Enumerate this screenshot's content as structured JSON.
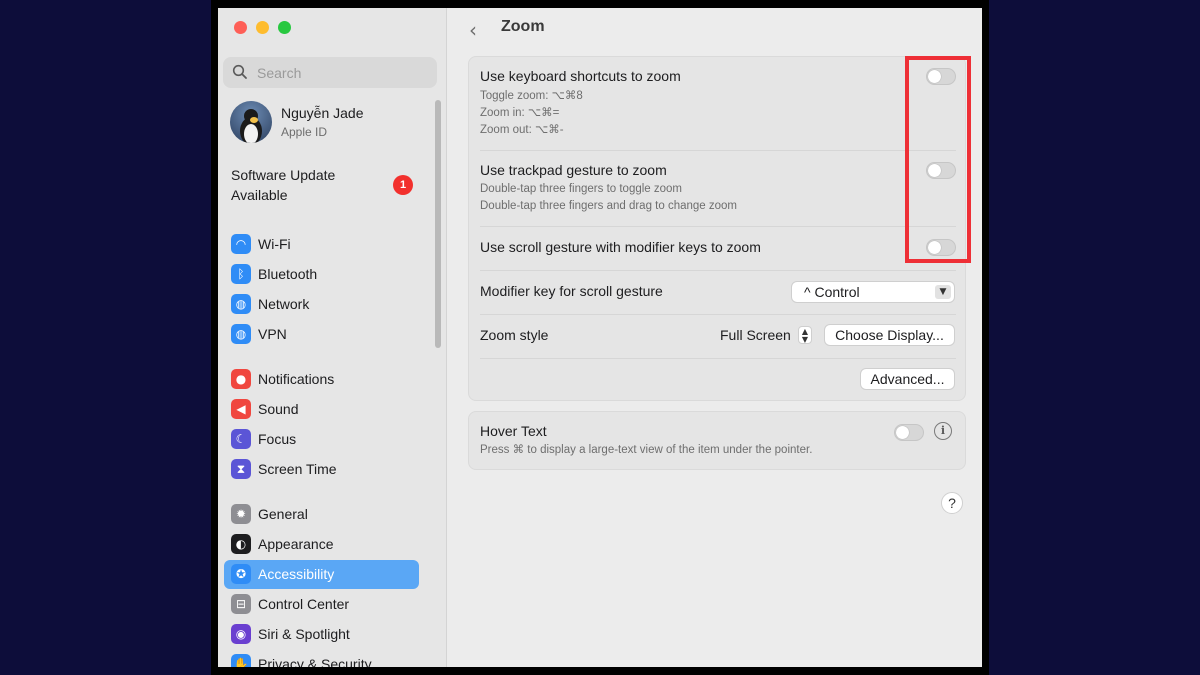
{
  "search": {
    "placeholder": "Search"
  },
  "profile": {
    "name": "Nguyễn Jade",
    "subtitle": "Apple ID"
  },
  "update": {
    "label": "Software Update Available",
    "badge": "1"
  },
  "sidebar": {
    "items": [
      {
        "label": "Wi-Fi",
        "icon": "wifi-icon",
        "color": "#2f8cf6"
      },
      {
        "label": "Bluetooth",
        "icon": "bluetooth-icon",
        "color": "#2f8cf6"
      },
      {
        "label": "Network",
        "icon": "globe-icon",
        "color": "#2f8cf6"
      },
      {
        "label": "VPN",
        "icon": "vpn-globe-icon",
        "color": "#2f8cf6"
      },
      {
        "label": "Notifications",
        "icon": "bell-icon",
        "color": "#f0473f"
      },
      {
        "label": "Sound",
        "icon": "speaker-icon",
        "color": "#f0473f"
      },
      {
        "label": "Focus",
        "icon": "moon-icon",
        "color": "#5b55d6"
      },
      {
        "label": "Screen Time",
        "icon": "hourglass-icon",
        "color": "#5b55d6"
      },
      {
        "label": "General",
        "icon": "gear-icon",
        "color": "#8e8e93"
      },
      {
        "label": "Appearance",
        "icon": "appearance-icon",
        "color": "#1d1d1f"
      },
      {
        "label": "Accessibility",
        "icon": "accessibility-icon",
        "color": "#2f8cf6",
        "active": true
      },
      {
        "label": "Control Center",
        "icon": "switches-icon",
        "color": "#8e8e93"
      },
      {
        "label": "Siri & Spotlight",
        "icon": "siri-icon",
        "color": "#6a3fd0"
      },
      {
        "label": "Privacy & Security",
        "icon": "hand-icon",
        "color": "#2f8cf6"
      }
    ]
  },
  "content": {
    "title": "Zoom",
    "keyboard": {
      "title": "Use keyboard shortcuts to zoom",
      "lines": [
        "Toggle zoom: ⌥⌘8",
        "Zoom in: ⌥⌘=",
        "Zoom out: ⌥⌘-"
      ]
    },
    "trackpad": {
      "title": "Use trackpad gesture to zoom",
      "lines": [
        "Double-tap three fingers to toggle zoom",
        "Double-tap three fingers and drag to change zoom"
      ]
    },
    "scroll": {
      "title": "Use scroll gesture with modifier keys to zoom"
    },
    "modifier": {
      "label": "Modifier key for scroll gesture",
      "value": "^ Control"
    },
    "style": {
      "label": "Zoom style",
      "value": "Full Screen",
      "button": "Choose Display..."
    },
    "advanced": "Advanced...",
    "hover": {
      "title": "Hover Text",
      "subtitle": "Press ⌘ to display a large-text view of the item under the pointer."
    },
    "help": "?"
  }
}
